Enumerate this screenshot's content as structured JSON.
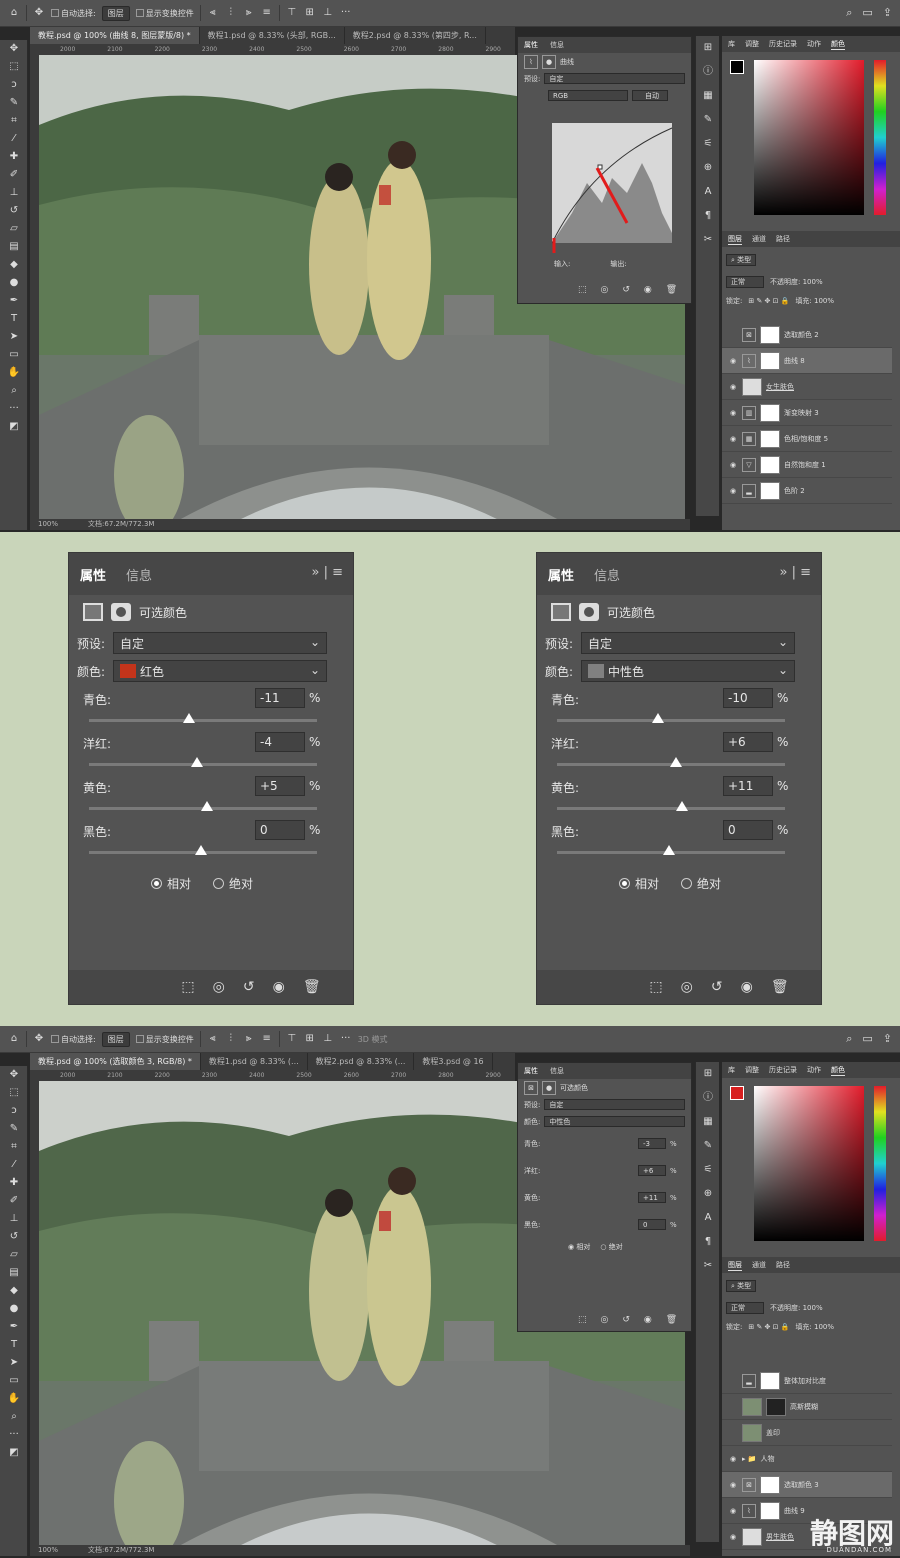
{
  "top_window": {
    "options": {
      "auto_select": "自动选择:",
      "layer_mode": "图层",
      "show_transform": "显示变换控件"
    },
    "tabs": [
      "教程.psd @ 100% (曲线 8, 图层蒙版/8) *",
      "教程1.psd @ 8.33% (头部, RGB...",
      "教程2.psd @ 8.33% (第四步, R..."
    ],
    "ruler_ticks": [
      "2000",
      "2100",
      "2200",
      "2300",
      "2400",
      "2500",
      "2600",
      "2700",
      "2800",
      "2900",
      "3000",
      "3100",
      "3200"
    ],
    "zoom": "100%",
    "doc_size": "文档:67.2M/772.3M",
    "properties": {
      "tabs": [
        "属性",
        "信息"
      ],
      "adj_name": "曲线",
      "preset_label": "预设:",
      "preset_value": "自定",
      "channel_value": "RGB",
      "auto_label": "自动",
      "input_label": "输入:",
      "output_label": "输出:"
    },
    "right_tabs": [
      "库",
      "调整",
      "历史记录",
      "动作",
      "颜色"
    ],
    "layers_tabs": [
      "图层",
      "通道",
      "路径"
    ],
    "layer_kind": "类型",
    "blend_mode": "正常",
    "opacity": "不透明度: 100%",
    "lock_label": "锁定:",
    "fill": "填充: 100%",
    "layers": [
      "选取颜色 2",
      "曲线 8",
      "女生肤色",
      "渐变映射 3",
      "色相/饱和度 5",
      "自然饱和度 1",
      "色阶 2"
    ]
  },
  "middle_left": {
    "tabs": [
      "属性",
      "信息"
    ],
    "adj_name": "可选颜色",
    "preset_label": "预设:",
    "preset_value": "自定",
    "color_label": "颜色:",
    "color_value": "红色",
    "swatch": "#c3341b",
    "sliders": [
      {
        "label": "青色:",
        "value": "-11",
        "unit": "%"
      },
      {
        "label": "洋红:",
        "value": "-4",
        "unit": "%"
      },
      {
        "label": "黄色:",
        "value": "+5",
        "unit": "%"
      },
      {
        "label": "黑色:",
        "value": "0",
        "unit": "%"
      }
    ],
    "relative": "相对",
    "absolute": "绝对"
  },
  "middle_right": {
    "tabs": [
      "属性",
      "信息"
    ],
    "adj_name": "可选颜色",
    "preset_label": "预设:",
    "preset_value": "自定",
    "color_label": "颜色:",
    "color_value": "中性色",
    "swatch": "#808080",
    "sliders": [
      {
        "label": "青色:",
        "value": "-10",
        "unit": "%"
      },
      {
        "label": "洋红:",
        "value": "+6",
        "unit": "%"
      },
      {
        "label": "黄色:",
        "value": "+11",
        "unit": "%"
      },
      {
        "label": "黑色:",
        "value": "0",
        "unit": "%"
      }
    ],
    "relative": "相对",
    "absolute": "绝对"
  },
  "bottom_window": {
    "options": {
      "auto_select": "自动选择:",
      "layer_mode": "图层",
      "show_transform": "显示变换控件",
      "mode_3d": "3D 模式"
    },
    "tabs": [
      "教程.psd @ 100% (选取颜色 3, RGB/8) *",
      "教程1.psd @ 8.33% (...",
      "教程2.psd @ 8.33% (...",
      "教程3.psd @ 16"
    ],
    "ruler_ticks": [
      "2000",
      "2100",
      "2200",
      "2300",
      "2400",
      "2500",
      "2600",
      "2700",
      "2800",
      "2900",
      "3000",
      "3100",
      "3200"
    ],
    "zoom": "100%",
    "doc_size": "文档:67.2M/772.3M",
    "properties": {
      "tabs": [
        "属性",
        "信息"
      ],
      "adj_name": "可选颜色",
      "preset_label": "预设:",
      "preset_value": "自定",
      "color_label": "颜色:",
      "color_value": "中性色",
      "sliders": [
        {
          "label": "青色:",
          "value": "-3",
          "unit": "%"
        },
        {
          "label": "洋红:",
          "value": "+6",
          "unit": "%"
        },
        {
          "label": "黄色:",
          "value": "+11",
          "unit": "%"
        },
        {
          "label": "黑色:",
          "value": "0",
          "unit": "%"
        }
      ],
      "relative": "相对",
      "absolute": "绝对"
    },
    "right_tabs": [
      "库",
      "调整",
      "历史记录",
      "动作",
      "颜色"
    ],
    "layers_tabs": [
      "图层",
      "通道",
      "路径"
    ],
    "layer_kind": "类型",
    "blend_mode": "正常",
    "opacity": "不透明度: 100%",
    "lock_label": "锁定:",
    "fill": "填充: 100%",
    "layers": [
      "整体加对比度",
      "高斯模糊",
      "盖印",
      "人物",
      "选取颜色 3",
      "曲线 9",
      "男生肤色"
    ]
  },
  "watermark": {
    "text": "静图网",
    "url": "DUANDAN.COM"
  }
}
